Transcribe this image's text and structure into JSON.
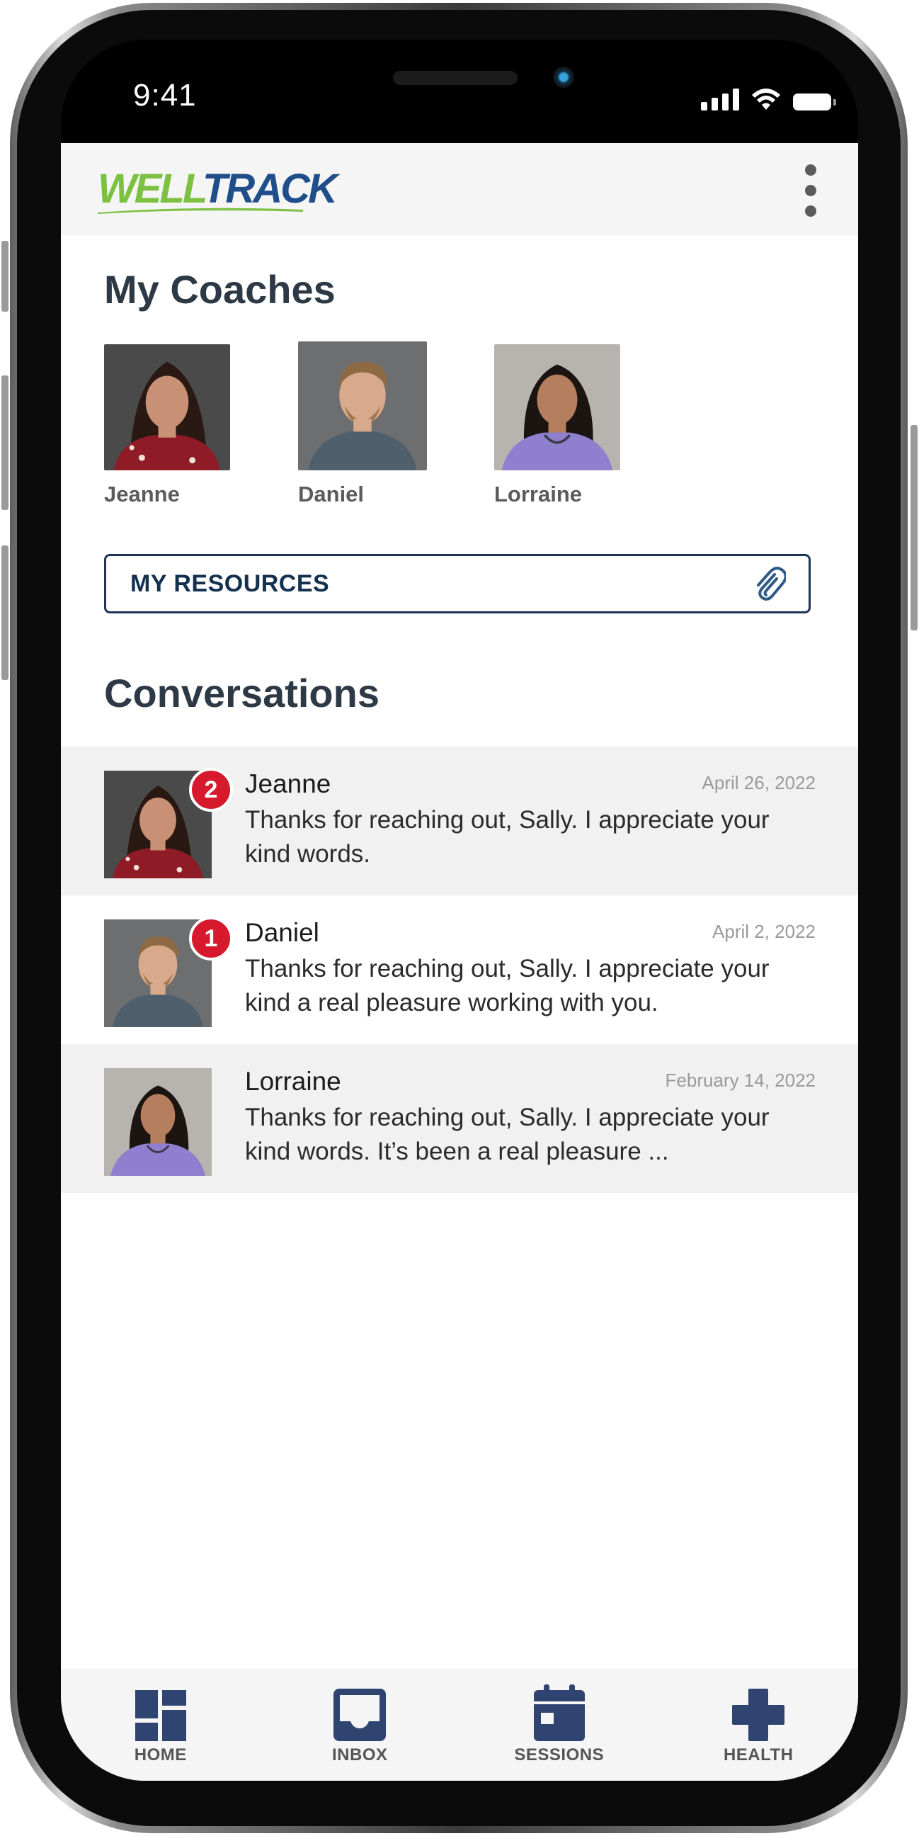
{
  "status_bar": {
    "time": "9:41"
  },
  "header": {
    "logo_part1": "WELL",
    "logo_part2": "TRACK"
  },
  "coaches": {
    "title": "My Coaches",
    "items": [
      {
        "name": "Jeanne"
      },
      {
        "name": "Daniel"
      },
      {
        "name": "Lorraine"
      }
    ]
  },
  "resources": {
    "label": "MY RESOURCES",
    "icon": "paperclip-icon"
  },
  "conversations": {
    "title": "Conversations",
    "items": [
      {
        "name": "Jeanne",
        "date": "April 26, 2022",
        "unread": "2",
        "message": "Thanks for reaching out, Sally. I appreciate your kind words."
      },
      {
        "name": "Daniel",
        "date": "April 2, 2022",
        "unread": "1",
        "message": "Thanks for reaching out, Sally. I appreciate your kind a real pleasure working with you."
      },
      {
        "name": "Lorraine",
        "date": "February 14, 2022",
        "unread": "",
        "message": "Thanks for reaching out, Sally. I appreciate your kind words. It’s been a real pleasure ..."
      }
    ]
  },
  "tabs": [
    {
      "label": "HOME",
      "icon": "dashboard-icon"
    },
    {
      "label": "INBOX",
      "icon": "inbox-icon"
    },
    {
      "label": "SESSIONS",
      "icon": "calendar-icon"
    },
    {
      "label": "HEALTH",
      "icon": "plus-cross-icon"
    }
  ],
  "colors": {
    "brand_green": "#7cc142",
    "brand_blue": "#1f4e8a",
    "nav_icon": "#2f4470",
    "badge_red": "#d6192c",
    "heading": "#2d3a45"
  }
}
